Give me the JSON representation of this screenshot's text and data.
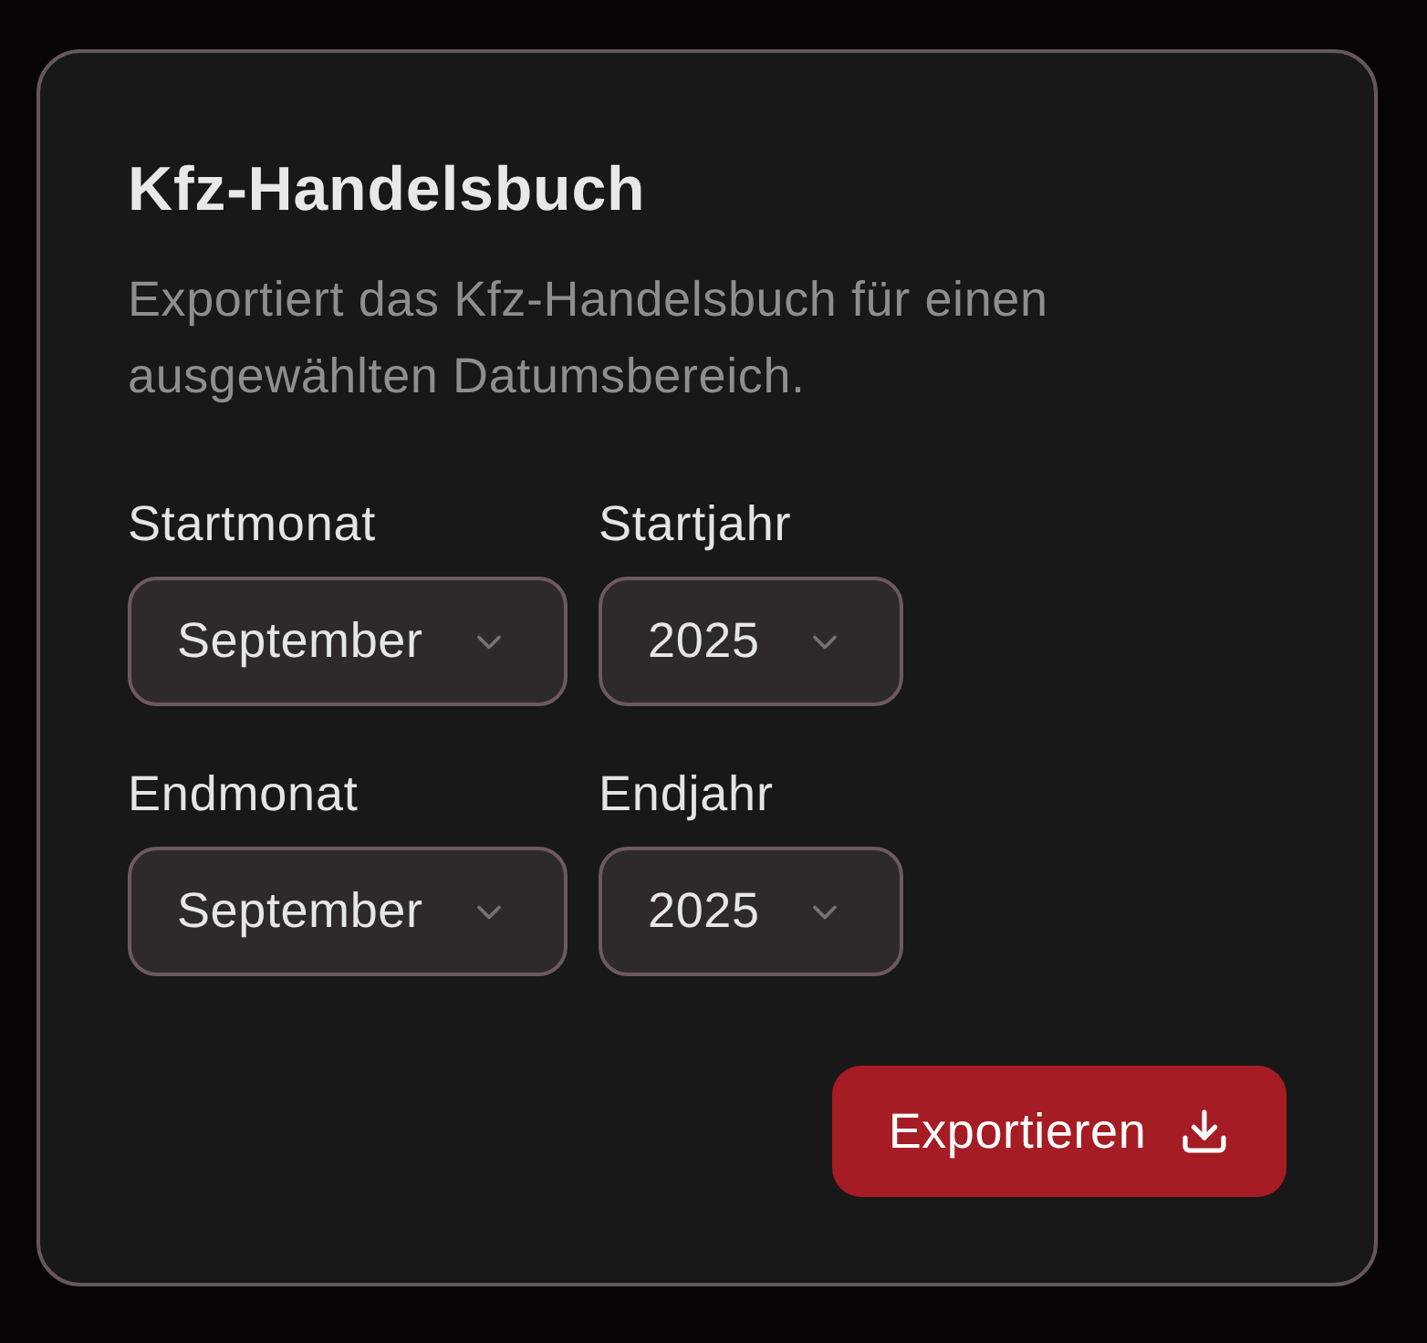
{
  "card": {
    "title": "Kfz-Handelsbuch",
    "description": "Exportiert das Kfz-Handelsbuch für einen ausgewählten Datumsbereich."
  },
  "field_rows": [
    [
      {
        "kind": "month",
        "label": "Startmonat",
        "value": "September"
      },
      {
        "kind": "year",
        "label": "Startjahr",
        "value": "2025"
      }
    ],
    [
      {
        "kind": "month",
        "label": "Endmonat",
        "value": "September"
      },
      {
        "kind": "year",
        "label": "Endjahr",
        "value": "2025"
      }
    ]
  ],
  "export_button": {
    "label": "Exportieren"
  }
}
